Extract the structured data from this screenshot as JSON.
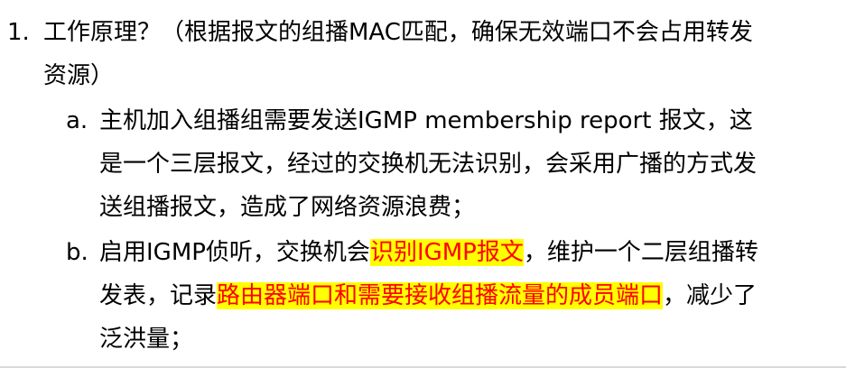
{
  "item1": {
    "marker": "1.",
    "line1": "工作原理？（根据报文的组播MAC匹配，确保无效端口不会占用转发",
    "line2": "资源）"
  },
  "item_a": {
    "marker": "a.",
    "line1": "主机加入组播组需要发送IGMP membership report 报文，这",
    "line2": "是一个三层报文，经过的交换机无法识别，会采用广播的方式发",
    "line3": "送组播报文，造成了网络资源浪费；"
  },
  "item_b": {
    "marker": "b.",
    "line1_pre": "启用IGMP侦听，交换机会",
    "line1_hl": "识别IGMP报文",
    "line1_post": "，维护一个二层组播转",
    "line2_pre": "发表，记录",
    "line2_hl": "路由器端口和需要接收组播流量的成员端口",
    "line2_post": "，减少了",
    "line3": "泛洪量；"
  },
  "colors": {
    "highlight_background": "#ffff00",
    "highlight_text": "#ff0000",
    "text": "#000000"
  }
}
